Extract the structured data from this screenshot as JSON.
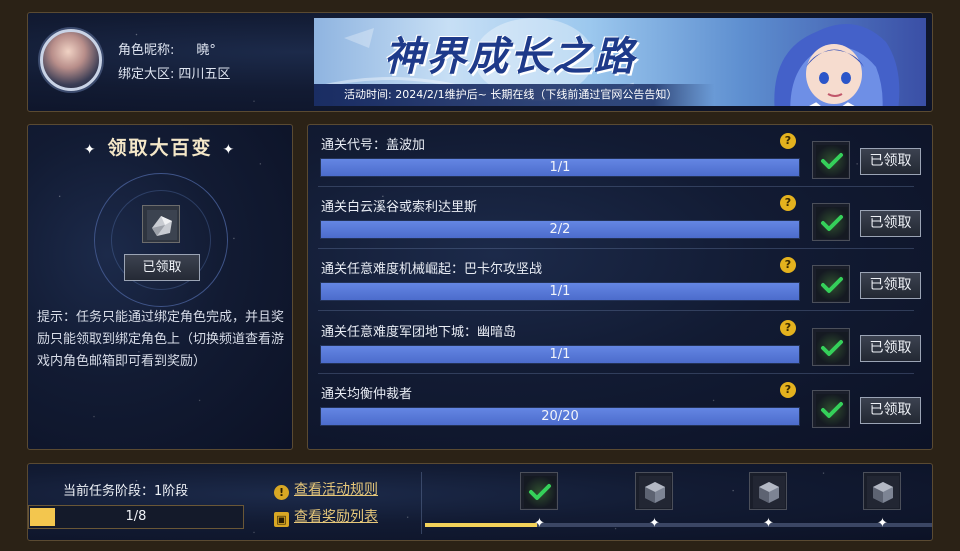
{
  "profile": {
    "nickname_label": "角色昵称:",
    "nickname": "曉°",
    "server_label": "绑定大区:",
    "server": "四川五区"
  },
  "banner": {
    "title": "神界成长之路",
    "subtitle": "活动时间: 2024/2/1维护后~ 长期在线（下线前通过官网公告告知）"
  },
  "grand_reward": {
    "title": "领取大百变",
    "claim_label": "已领取",
    "tip": "提示：任务只能通过绑定角色完成，并且奖励只能领取到绑定角色上（切换频道查看游戏内角色邮箱即可看到奖励）"
  },
  "tasks": [
    {
      "title": "通关代号：盖波加",
      "progress": "1/1",
      "fraction": 1.0,
      "claim_label": "已领取",
      "help": "?"
    },
    {
      "title": "通关白云溪谷或索利达里斯",
      "progress": "2/2",
      "fraction": 1.0,
      "claim_label": "已领取",
      "help": "?"
    },
    {
      "title": "通关任意难度机械崛起：巴卡尔攻坚战",
      "progress": "1/1",
      "fraction": 1.0,
      "claim_label": "已领取",
      "help": "?"
    },
    {
      "title": "通关任意难度军团地下城：幽暗岛",
      "progress": "1/1",
      "fraction": 1.0,
      "claim_label": "已领取",
      "help": "?"
    },
    {
      "title": "通关均衡仲裁者",
      "progress": "20/20",
      "fraction": 1.0,
      "claim_label": "已领取",
      "help": "?"
    }
  ],
  "stage": {
    "label": "当前任务阶段：1阶段",
    "progress": "1/8",
    "fraction": 0.125,
    "track_fraction": 0.22
  },
  "links": {
    "rules": "查看活动规则",
    "rewards": "查看奖励列表"
  },
  "stage_icons": [
    {
      "state": "completed"
    },
    {
      "state": "locked"
    },
    {
      "state": "locked"
    },
    {
      "state": "locked"
    }
  ],
  "colors": {
    "bar_fill": "#5b7de0",
    "stage_fill": "#f3c64e",
    "check": "#35d05a",
    "help": "#e4b21e"
  }
}
